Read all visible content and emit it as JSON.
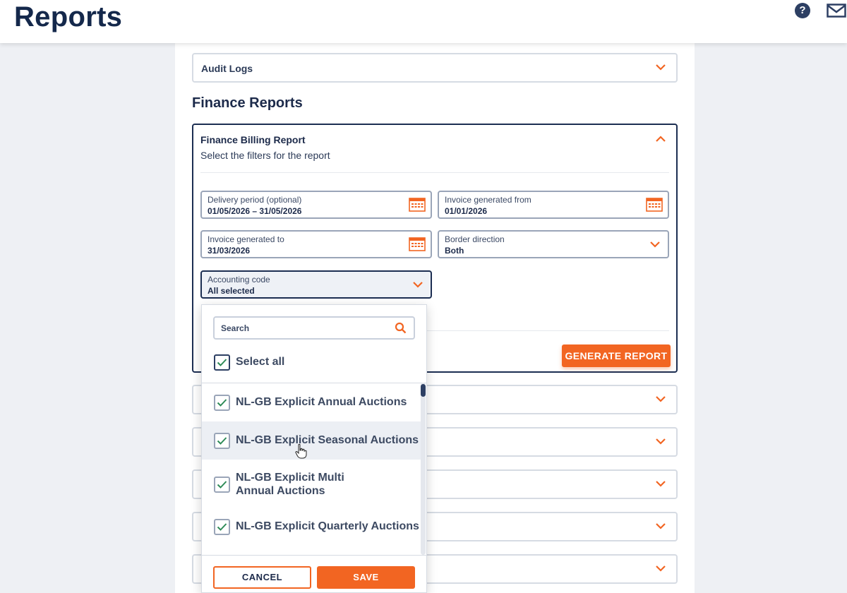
{
  "header": {
    "title": "Reports",
    "help_icon": "question-circle-icon",
    "mail_icon": "envelope-icon"
  },
  "audit": {
    "label": "Audit Logs"
  },
  "finance": {
    "section_title": "Finance Reports",
    "billing": {
      "title": "Finance Billing Report",
      "subtitle": "Select the filters for the report",
      "delivery": {
        "label": "Delivery period (optional)",
        "value": "01/05/2026 – 31/05/2026"
      },
      "invoice_from": {
        "label": "Invoice generated from",
        "value": "01/01/2026"
      },
      "invoice_to": {
        "label": "Invoice generated to",
        "value": "31/03/2026"
      },
      "border": {
        "label": "Border direction",
        "value": "Both"
      },
      "accounting": {
        "label": "Accounting code",
        "value": "All selected"
      },
      "generate_label": "GENERATE REPORT"
    }
  },
  "dropdown": {
    "search_placeholder": "Search",
    "select_all_label": "Select all",
    "items": [
      {
        "label": "NL-GB Explicit Annual Auctions",
        "checked": true
      },
      {
        "label": "NL-GB Explicit Seasonal Auctions",
        "checked": true
      },
      {
        "label": "NL-GB Explicit Multi Annual Auctions",
        "checked": true
      },
      {
        "label": "NL-GB Explicit Quarterly Auctions",
        "checked": true
      }
    ],
    "cancel_label": "CANCEL",
    "save_label": "SAVE"
  },
  "colors": {
    "accent": "#f26522",
    "navy": "#1c2e52",
    "check": "#2e8b57"
  }
}
